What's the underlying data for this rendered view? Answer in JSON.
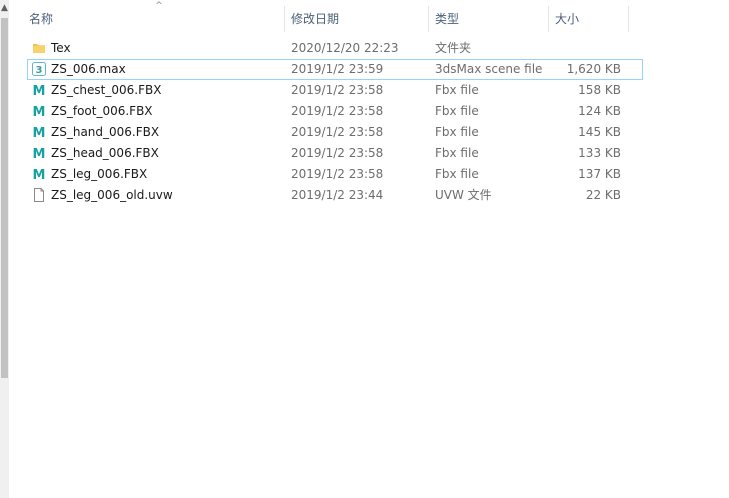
{
  "header": {
    "name": "名称",
    "date_modified": "修改日期",
    "type": "类型",
    "size": "大小"
  },
  "files": [
    {
      "icon": "folder-icon",
      "name": "Tex",
      "date": "2020/12/20 22:23",
      "type": "文件夹",
      "size": "",
      "selected": false
    },
    {
      "icon": "3dsmax-icon",
      "name": "ZS_006.max",
      "date": "2019/1/2 23:59",
      "type": "3dsMax scene file",
      "size": "1,620 KB",
      "selected": true
    },
    {
      "icon": "fbx-icon",
      "name": "ZS_chest_006.FBX",
      "date": "2019/1/2 23:58",
      "type": "Fbx file",
      "size": "158 KB",
      "selected": false
    },
    {
      "icon": "fbx-icon",
      "name": "ZS_foot_006.FBX",
      "date": "2019/1/2 23:58",
      "type": "Fbx file",
      "size": "124 KB",
      "selected": false
    },
    {
      "icon": "fbx-icon",
      "name": "ZS_hand_006.FBX",
      "date": "2019/1/2 23:58",
      "type": "Fbx file",
      "size": "145 KB",
      "selected": false
    },
    {
      "icon": "fbx-icon",
      "name": "ZS_head_006.FBX",
      "date": "2019/1/2 23:58",
      "type": "Fbx file",
      "size": "133 KB",
      "selected": false
    },
    {
      "icon": "fbx-icon",
      "name": "ZS_leg_006.FBX",
      "date": "2019/1/2 23:58",
      "type": "Fbx file",
      "size": "137 KB",
      "selected": false
    },
    {
      "icon": "blank-file-icon",
      "name": "ZS_leg_006_old.uvw",
      "date": "2019/1/2 23:44",
      "type": "UVW 文件",
      "size": "22 KB",
      "selected": false
    }
  ],
  "colors": {
    "selection_border": "#99d1ff",
    "header_text": "#4c607a",
    "folder": "#f2c14e",
    "fbx": "#17a2a2"
  }
}
